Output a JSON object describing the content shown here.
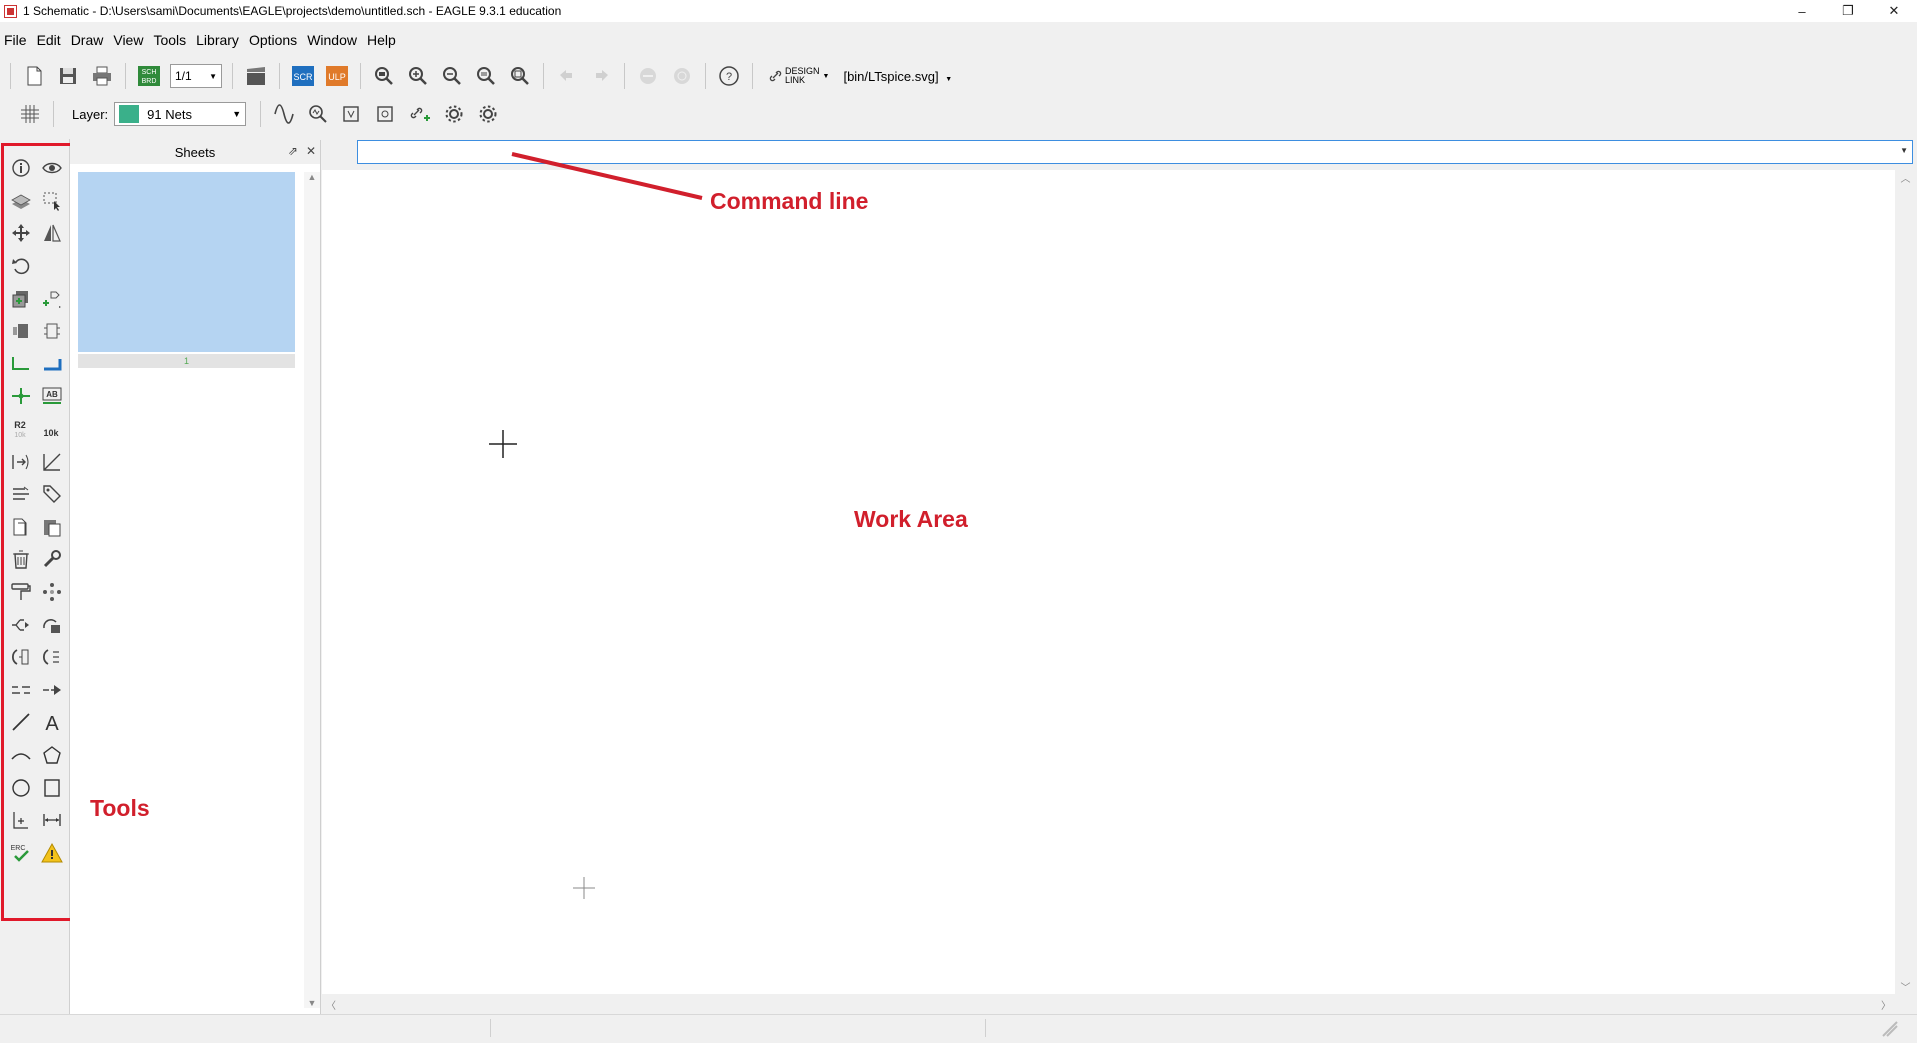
{
  "window": {
    "title": "1 Schematic - D:\\Users\\sami\\Documents\\EAGLE\\projects\\demo\\untitled.sch - EAGLE 9.3.1 education",
    "controls": [
      "–",
      "❐",
      "✕"
    ]
  },
  "menu": [
    "File",
    "Edit",
    "Draw",
    "View",
    "Tools",
    "Library",
    "Options",
    "Window",
    "Help"
  ],
  "toolbar": {
    "sheet_value": "1/1",
    "scr_label": "SCR",
    "ulp_label": "ULP",
    "sch_brd_label": "SCH BRD",
    "help_label": "?",
    "design_link_label_1": "DESIGN",
    "design_link_label_2": "LINK",
    "ulp_path": "[bin/LTspice.svg]"
  },
  "layer": {
    "label": "Layer:",
    "value": "91 Nets",
    "color": "#3ab08a"
  },
  "sheets": {
    "title": "Sheets",
    "sheet_number": "1"
  },
  "command_line": {
    "value": ""
  },
  "annotations": {
    "command_line": "Command line",
    "work_area": "Work Area",
    "tools": "Tools",
    "color": "#d11f2c"
  },
  "tool_labels": {
    "erc": "ERC",
    "r2": "R2",
    "r2_value": "10k",
    "value_label": "10k",
    "ab": "AB",
    "text": "A"
  }
}
